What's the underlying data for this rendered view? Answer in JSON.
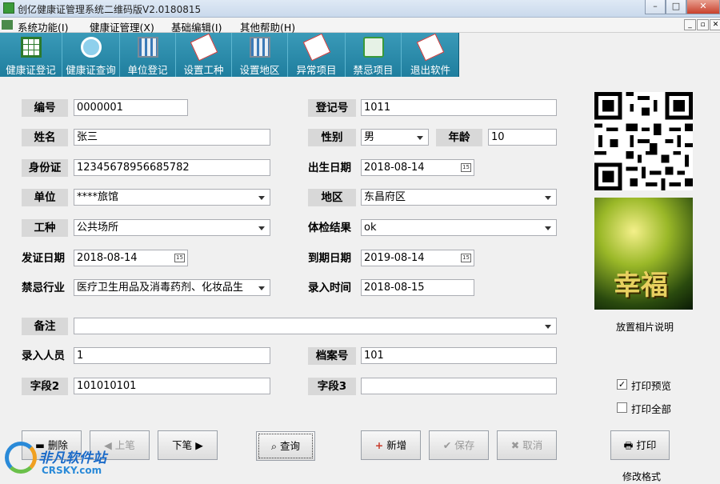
{
  "window": {
    "title": "创亿健康证管理系统二维码版V2.0180815",
    "min": "–",
    "max": "□",
    "close": "✕"
  },
  "menu": [
    "系统功能(I)",
    "健康证管理(X)",
    "基础编辑(I)",
    "其他帮助(H)"
  ],
  "mdi_controls": [
    "_",
    "▫",
    "✕"
  ],
  "toolbar": [
    "健康证登记",
    "健康证查询",
    "单位登记",
    "设置工种",
    "设置地区",
    "异常项目",
    "禁忌项目",
    "退出软件"
  ],
  "form": {
    "number": {
      "label": "编号",
      "value": "0000001"
    },
    "name": {
      "label": "姓名",
      "value": "张三"
    },
    "id_card": {
      "label": "身份证",
      "value": "12345678956685782"
    },
    "unit": {
      "label": "单位",
      "value": "****旅馆"
    },
    "job": {
      "label": "工种",
      "value": "公共场所"
    },
    "issue_date": {
      "label": "发证日期",
      "value": "2018-08-14"
    },
    "forbidden": {
      "label": "禁忌行业",
      "value": "医疗卫生用品及消毒药剂、化妆品生"
    },
    "remark": {
      "label": "备注",
      "value": ""
    },
    "entry_person": {
      "label": "录入人员",
      "value": "1"
    },
    "field2": {
      "label": "字段2",
      "value": "101010101"
    },
    "reg_no": {
      "label": "登记号",
      "value": "1011"
    },
    "gender": {
      "label": "性别",
      "value": "男"
    },
    "age": {
      "label": "年龄",
      "value": "10"
    },
    "birth": {
      "label": "出生日期",
      "value": "2018-08-14"
    },
    "region": {
      "label": "地区",
      "value": "东昌府区"
    },
    "result": {
      "label": "体检结果",
      "value": "ok"
    },
    "expire": {
      "label": "到期日期",
      "value": "2019-08-14"
    },
    "entry_time": {
      "label": "录入时间",
      "value": "2018-08-15"
    },
    "archive": {
      "label": "档案号",
      "value": "101"
    },
    "field3": {
      "label": "字段3",
      "value": ""
    }
  },
  "photo": {
    "text": "幸福",
    "caption": "放置相片说明"
  },
  "checkboxes": {
    "print_preview": {
      "label": "打印预览",
      "checked": true
    },
    "print_all": {
      "label": "打印全部",
      "checked": false
    }
  },
  "buttons": {
    "delete": "删除",
    "prev": "上笔",
    "next": "下笔",
    "query": "查询",
    "add": "新增",
    "save": "保存",
    "cancel": "取消",
    "print": "打印"
  },
  "footer": {
    "format_link": "修改格式"
  },
  "watermark": {
    "cn": "非凡软件站",
    "en": "CRSKY.com"
  },
  "colors": {
    "toolbar": "#2a8cae",
    "label_bg": "#d8d8d8"
  }
}
